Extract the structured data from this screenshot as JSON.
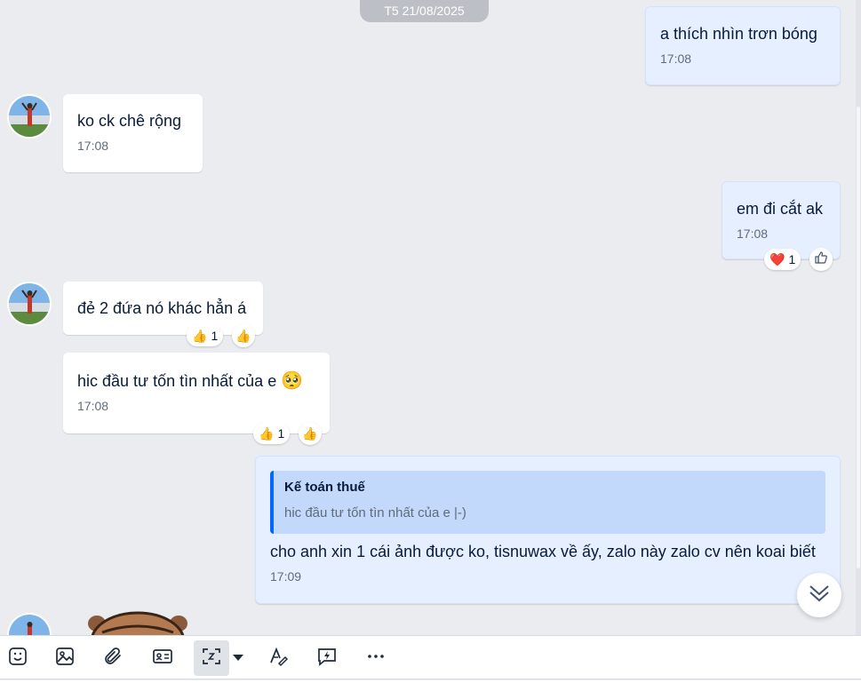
{
  "chat": {
    "date_separator": "T5 21/08/2025",
    "messages": [
      {
        "id": "m1",
        "direction": "out",
        "text": "a thích nhìn trơn bóng",
        "time": "17:08"
      },
      {
        "id": "m2",
        "direction": "in",
        "text": "ko ck chê rộng",
        "time": "17:08"
      },
      {
        "id": "m3",
        "direction": "out",
        "text": "em đi cắt ak",
        "time": "17:08",
        "reaction": {
          "emoji": "❤️",
          "count": "1"
        }
      },
      {
        "id": "m4",
        "direction": "in",
        "text": "đẻ 2 đứa nó khác hẳn á",
        "reaction": {
          "emoji": "👍",
          "count": "1"
        }
      },
      {
        "id": "m5",
        "direction": "in",
        "text": "hic đầu tư tốn tìn nhất của e",
        "emoji": "🥺",
        "time": "17:08",
        "reaction": {
          "emoji": "👍",
          "count": "1"
        }
      },
      {
        "id": "m6",
        "direction": "out",
        "quote": {
          "name": "Kế toán thuế",
          "text": "hic đầu tư tốn tìn nhất của e |-)"
        },
        "text": "cho anh xin 1 cái ảnh được ko, tisnuwax về ấy, zalo này zalo cv nên koai biết",
        "time": "17:09"
      }
    ]
  },
  "toolbar": {
    "icons": [
      "sticker-icon",
      "image-icon",
      "attachment-icon",
      "contact-card-icon",
      "screenshot-icon",
      "dropdown-caret-icon",
      "text-format-icon",
      "quick-message-icon",
      "more-icon"
    ]
  },
  "colors": {
    "background": "#ebecf0",
    "bubble_out": "#e5efff",
    "bubble_in": "#ffffff",
    "accent": "#0068ff",
    "quote_bg": "#c3d9fb"
  }
}
